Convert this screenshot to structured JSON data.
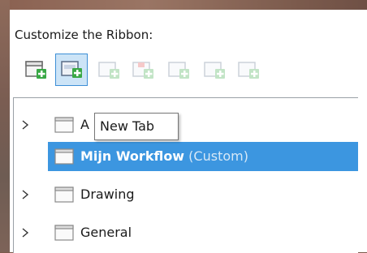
{
  "panel": {
    "title": "Customize the Ribbon:"
  },
  "toolbar": {
    "buttons": [
      {
        "icon": "new-tab-icon",
        "enabled": true,
        "active": false
      },
      {
        "icon": "new-group-icon",
        "enabled": true,
        "active": true
      },
      {
        "icon": "new-command-icon",
        "enabled": false,
        "active": false
      },
      {
        "icon": "remove-icon",
        "enabled": false,
        "active": false
      },
      {
        "icon": "rename-icon",
        "enabled": false,
        "active": false
      },
      {
        "icon": "move-icon",
        "enabled": false,
        "active": false
      },
      {
        "icon": "reset-icon",
        "enabled": false,
        "active": false
      }
    ]
  },
  "tooltip": {
    "text": "New Tab"
  },
  "tree": {
    "items": [
      {
        "label": "A",
        "suffix": "",
        "expandable": true,
        "selected": false
      },
      {
        "label": "Mijn Workflow",
        "suffix": " (Custom)",
        "expandable": false,
        "selected": true
      },
      {
        "label": "Drawing",
        "suffix": "",
        "expandable": true,
        "selected": false
      },
      {
        "label": "General",
        "suffix": "",
        "expandable": true,
        "selected": false
      }
    ]
  },
  "colors": {
    "selection": "#3c96e0",
    "active_button_bg": "#cce4f7",
    "active_button_border": "#3d8fd6",
    "icon_green": "#39a845"
  }
}
